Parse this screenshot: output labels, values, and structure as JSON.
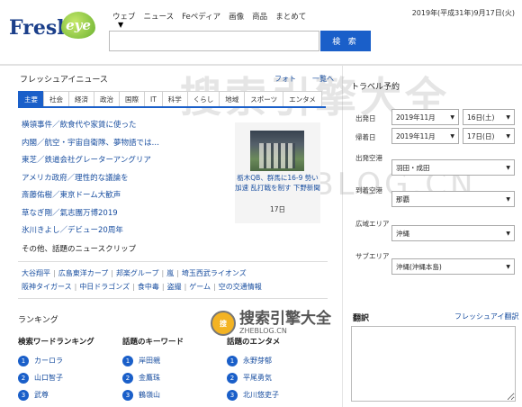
{
  "header": {
    "logo_text": "Fresh",
    "logo_eye": "eye",
    "nav": [
      "ウェブ",
      "ニュース",
      "Feペディア",
      "画像",
      "商品",
      "まとめて"
    ],
    "search_button": "検 索",
    "date": "2019年(平成31年)9月17日(火)"
  },
  "news": {
    "title": "フレッシュアイニュース",
    "link_photo": "フォト",
    "link_list": "一覧へ",
    "tabs": [
      "主要",
      "社会",
      "経済",
      "政治",
      "国際",
      "IT",
      "科学",
      "くらし",
      "地域",
      "スポーツ",
      "エンタメ"
    ],
    "active_tab": 0,
    "headlines": [
      "横領事件／飲食代や家賃に使った",
      "内閣／航空・宇宙自衛隊、夢物語では…",
      "東芝／鉄道会社グレーターアングリア",
      "アメリカ政府／理性的な議論を",
      "斎藤佑樹／東京ドーム大歓声",
      "草なぎ剛／氣志團万博2019",
      "氷川きよし／デビュー20周年"
    ],
    "photo_caption": "栃木QB、群馬に16-9 勢い加速 乱打戦を制す 下野新聞",
    "photo_date": "17日",
    "clip_title": "その他、話題のニュースクリップ",
    "clips_row1": [
      "大谷翔平",
      "広島東洋カープ",
      "邦楽グループ",
      "嵐",
      "埼玉西武ライオンズ"
    ],
    "clips_row2": [
      "阪神タイガース",
      "中日ドラゴンズ",
      "食中毒",
      "盗撮",
      "ゲーム",
      "空の交通情報"
    ]
  },
  "ranking": {
    "title": "ランキング",
    "columns": [
      {
        "title": "検索ワードランキング",
        "items": [
          "カーロラ",
          "山口智子",
          "武尊"
        ]
      },
      {
        "title": "話題のキーワード",
        "items": [
          "岸田親",
          "金鷹珠",
          "鶴嶺山"
        ]
      },
      {
        "title": "話題のエンタメ",
        "items": [
          "永野芽郁",
          "平尾勇気",
          "北川悠吏子"
        ]
      }
    ]
  },
  "travel": {
    "title": "トラベル予約",
    "depart_label": "出発日",
    "depart_month": "2019年11月",
    "depart_day": "16日(土)",
    "return_label": "帰着日",
    "return_month": "2019年11月",
    "return_day": "17日(日)",
    "from_airport_label": "出発空港",
    "from_airport": "羽田・成田",
    "to_airport_label": "到着空港",
    "to_airport": "那覇",
    "area_label": "広域エリア",
    "area": "沖縄",
    "subarea_label": "サブエリア",
    "subarea": "沖縄(沖縄本島)"
  },
  "translate": {
    "title": "翻訳",
    "link": "フレッシュアイ翻訳"
  },
  "watermark": {
    "big": "搜索引擎大全",
    "url": "ZHEBLOG.CN",
    "logo_icon": "搜",
    "logo_text": "搜索引擎大全",
    "logo_url": "ZHEBLOG.CN"
  },
  "colors": {
    "accent": "#1a5fc9",
    "link": "#1a4fa0"
  }
}
